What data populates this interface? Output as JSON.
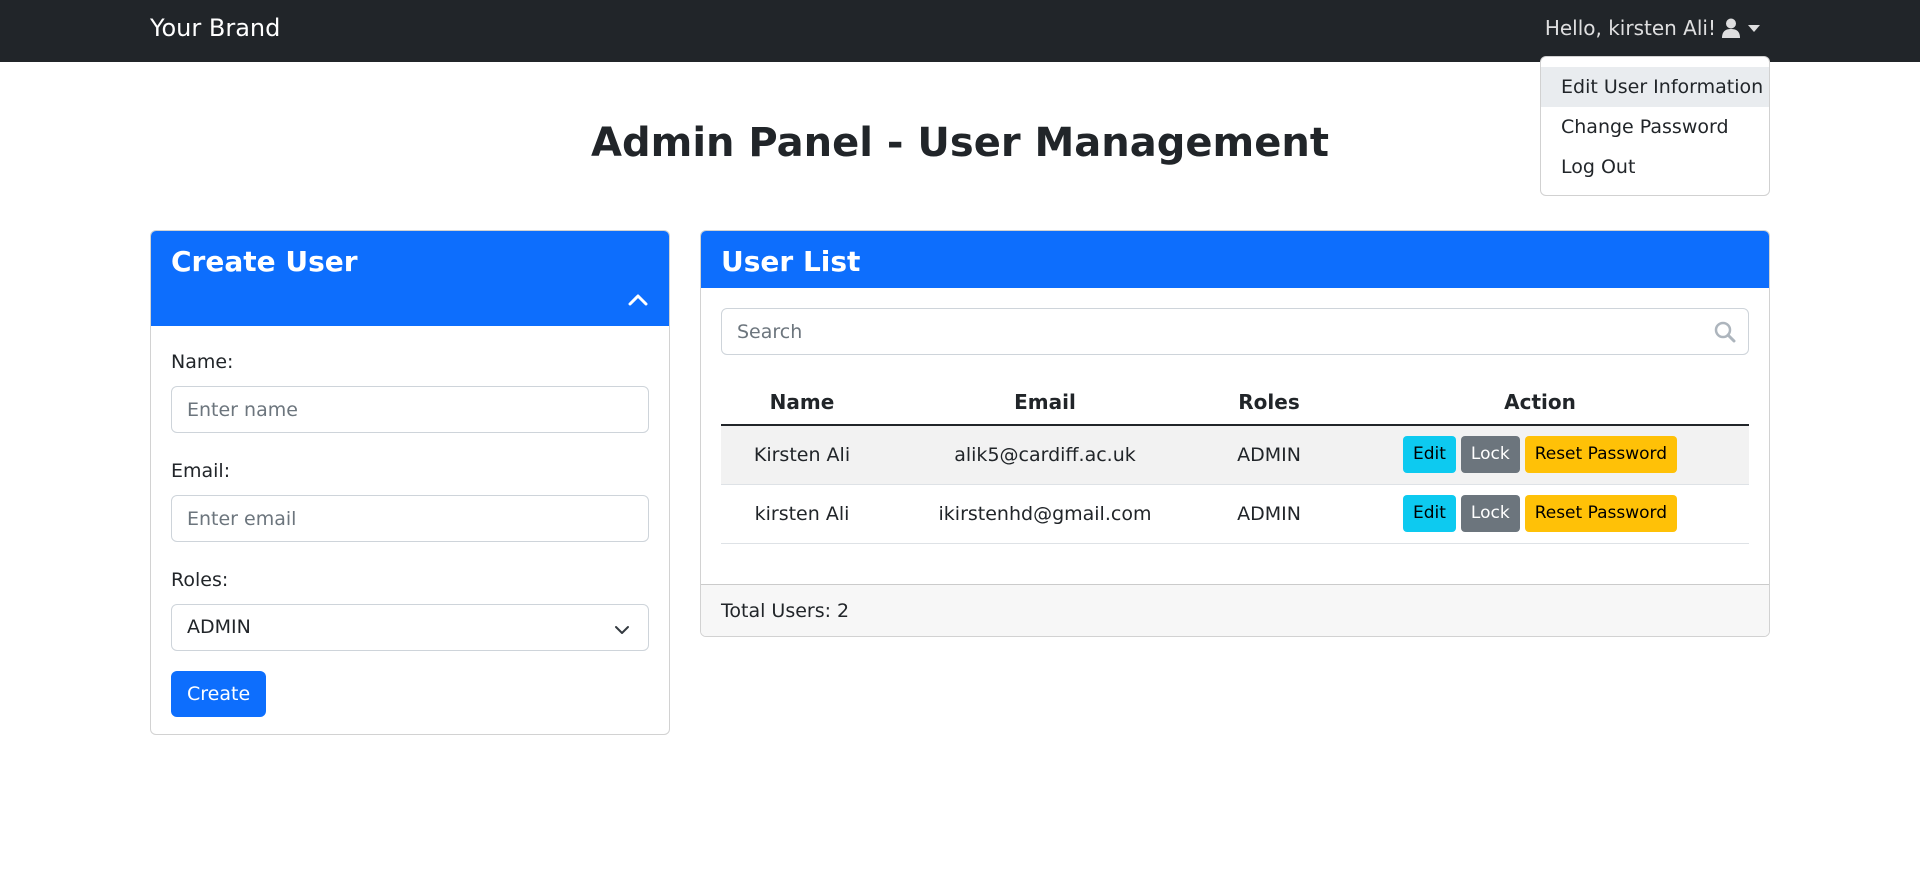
{
  "navbar": {
    "brand": "Your Brand",
    "greeting": "Hello, kirsten Ali!",
    "user_icon": "user-icon",
    "dropdown_items": [
      {
        "label": "Edit User Information",
        "active": true
      },
      {
        "label": "Change Password",
        "active": false
      },
      {
        "label": "Log Out",
        "active": false
      }
    ]
  },
  "page": {
    "title": "Admin Panel - User Management"
  },
  "create_user": {
    "title": "Create User",
    "collapse_icon": "chevron-up-icon",
    "name_label": "Name:",
    "name_placeholder": "Enter name",
    "email_label": "Email:",
    "email_placeholder": "Enter email",
    "roles_label": "Roles:",
    "roles_selected": "ADMIN",
    "create_button": "Create"
  },
  "user_list": {
    "title": "User List",
    "search_placeholder": "Search",
    "columns": [
      "Name",
      "Email",
      "Roles",
      "Action"
    ],
    "rows": [
      {
        "name": "Kirsten Ali",
        "email": "alik5@cardiff.ac.uk",
        "roles": "ADMIN"
      },
      {
        "name": "kirsten Ali",
        "email": "ikirstenhd@gmail.com",
        "roles": "ADMIN"
      }
    ],
    "actions": {
      "edit": "Edit",
      "lock": "Lock",
      "reset": "Reset Password"
    },
    "footer": "Total Users: 2"
  },
  "colors": {
    "primary": "#0d6efd",
    "navbar": "#212529",
    "info": "#0dcaf0",
    "secondary": "#6c757d",
    "warning": "#ffc107"
  }
}
